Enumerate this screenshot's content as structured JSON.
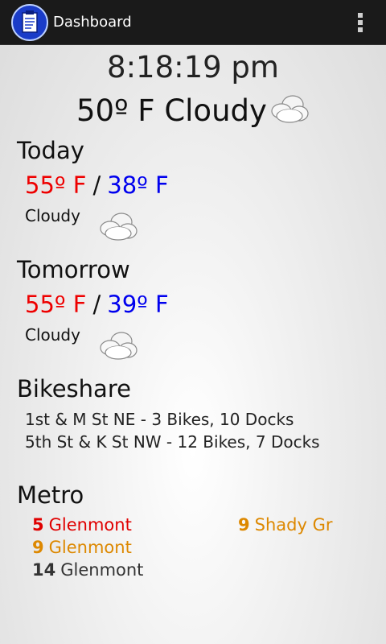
{
  "actionbar": {
    "title": "Dashboard",
    "app_icon": "clipboard-icon",
    "overflow_icon": "overflow-menu-icon"
  },
  "clock": {
    "time": "8:18:19 pm"
  },
  "current": {
    "text": "50º F Cloudy",
    "icon": "cloudy-icon"
  },
  "today": {
    "title": "Today",
    "high": "55º F",
    "separator": "/",
    "low": "38º F",
    "condition": "Cloudy",
    "icon": "cloudy-icon"
  },
  "tomorrow": {
    "title": "Tomorrow",
    "high": "55º F",
    "separator": "/",
    "low": "39º F",
    "condition": "Cloudy",
    "icon": "cloudy-icon"
  },
  "bikeshare": {
    "title": "Bikeshare",
    "stations": [
      "1st & M St NE - 3 Bikes, 10 Docks",
      "5th St & K St NW - 12 Bikes, 7 Docks"
    ]
  },
  "metro": {
    "title": "Metro",
    "arrivals": [
      {
        "minutes": "5",
        "destination": "Glenmont",
        "color": "#e00000"
      },
      {
        "minutes": "9",
        "destination": "Shady Gr",
        "color": "#dd8800"
      },
      {
        "minutes": "9",
        "destination": "Glenmont",
        "color": "#dd8800"
      },
      {
        "minutes": "14",
        "destination": "Glenmont",
        "color": "#333333"
      }
    ]
  },
  "colors": {
    "high_temp": "#ee0000",
    "low_temp": "#0000ee",
    "actionbar": "#1a1a1a"
  }
}
